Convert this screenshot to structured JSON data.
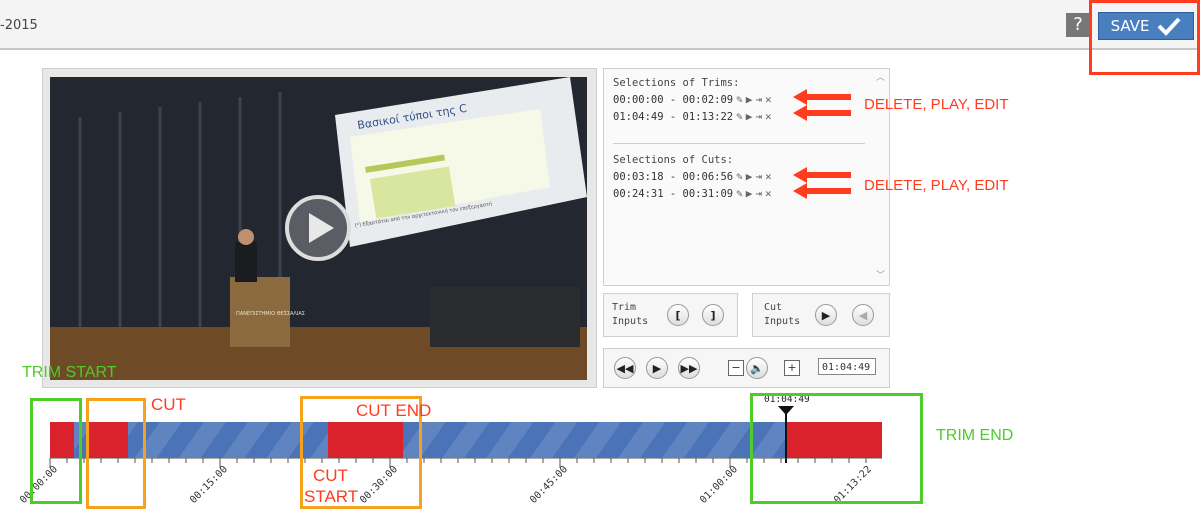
{
  "header": {
    "year_text": "-2015",
    "help_label": "?",
    "save_label": "SAVE"
  },
  "video": {
    "slide_title": "Βασικοί τύποι της C",
    "slide_bottom": "(*) Εξαρτάται από την αρχιτεκτονική του επεξεργαστή",
    "podium_text": "ΠΑΝΕΠΙΣΤΗΜΙΟ ΘΕΣΣΑΛΙΑΣ"
  },
  "selections": {
    "trims_title": "Selections of Trims:",
    "trims": [
      "00:00:00 - 00:02:09",
      "01:04:49 - 01:13:22"
    ],
    "cuts_title": "Selections of Cuts:",
    "cuts": [
      "00:03:18 - 00:06:56",
      "00:24:31 - 00:31:09"
    ]
  },
  "controls": {
    "trim_label": "Trim\nInputs",
    "cut_label": "Cut\nInputs",
    "time_value": "01:04:49",
    "minus": "−",
    "plus": "+"
  },
  "timeline": {
    "playhead_label": "01:04:49",
    "ticks": [
      "00:00:00",
      "00:15:00",
      "00:30:00",
      "00:45:00",
      "01:00:00",
      "01:13:22"
    ]
  },
  "annotations": {
    "delete_play_edit_1": "DELETE, PLAY, EDIT",
    "delete_play_edit_2": "DELETE, PLAY, EDIT",
    "trim_start": "TRIM START",
    "cut": "CUT",
    "cut_end": "CUT END",
    "cut_start_1": "CUT",
    "cut_start_2": "START",
    "trim_end": "TRIM END"
  },
  "colors": {
    "accent": "#4a7fbf",
    "annotation_red": "#ff3c1e",
    "annotation_green": "#4dcc2a",
    "annotation_orange": "#f5a31f",
    "segment_red": "#d9222c",
    "timeline_blue": "#4a73b8"
  }
}
